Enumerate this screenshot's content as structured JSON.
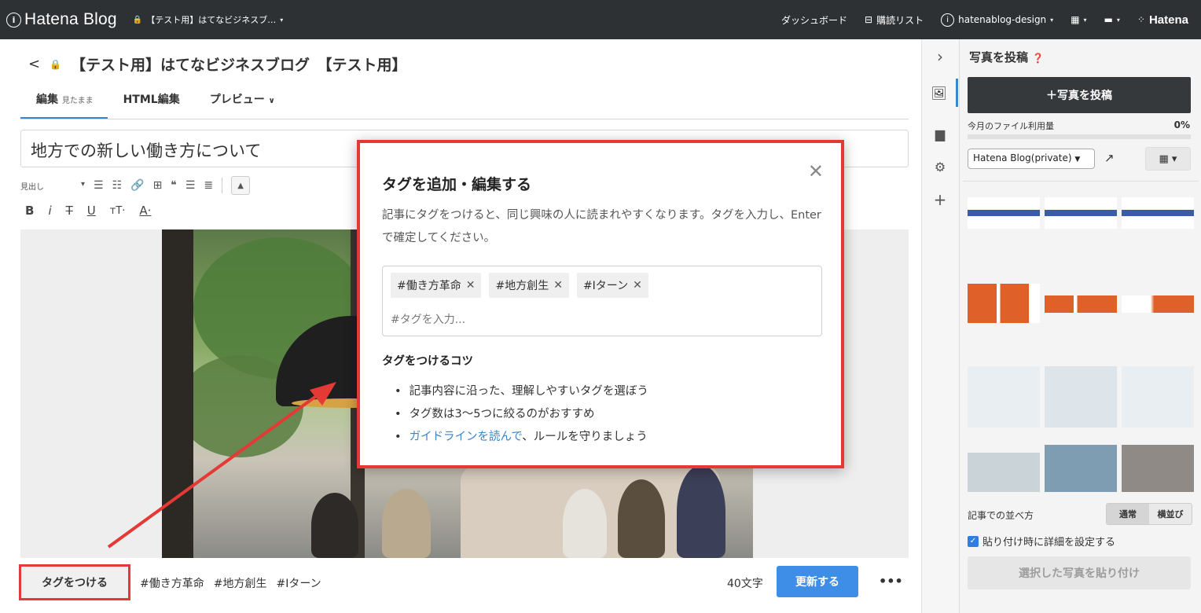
{
  "topbar": {
    "brand": "Hatena Blog",
    "brand_icon": "i",
    "blog_name": "【テスト用】はてなビジネスブ…",
    "dashboard": "ダッシュボード",
    "reading_list": "購読リスト",
    "user": "hatenablog-design",
    "hatena": "Hatena"
  },
  "editor": {
    "blog_title": "【テスト用】はてなビジネスブログ　【テスト用】",
    "tabs": {
      "edit": "編集",
      "edit_mode": "見たまま",
      "html": "HTML編集",
      "preview": "プレビュー"
    },
    "post_title": "地方での新しい働き方について",
    "heading_select": "見出し"
  },
  "bottom": {
    "tag_button": "タグをつける",
    "tags": [
      "#働き方革命",
      "#地方創生",
      "#Iターン"
    ],
    "char_count": "40文字",
    "update_button": "更新する",
    "more": "•••"
  },
  "panel": {
    "title": "写真を投稿",
    "post_button": "＋写真を投稿",
    "usage_label": "今月のファイル利用量",
    "usage_percent": "0%",
    "usage_value": 0,
    "album": "Hatena Blog(private)",
    "sort_label": "記事での並べ方",
    "sort_normal": "通常",
    "sort_horizontal": "横並び",
    "detail_checkbox": "貼り付け時に詳細を設定する",
    "paste_button": "選択した写真を貼り付け"
  },
  "modal": {
    "title": "タグを追加・編集する",
    "description": "記事にタグをつけると、同じ興味の人に読まれやすくなります。タグを入力し、Enterで確定してください。",
    "chips": [
      "#働き方革命",
      "#地方創生",
      "#Iターン"
    ],
    "input_placeholder": "#タグを入力...",
    "tips_title": "タグをつけるコツ",
    "tip1": "記事内容に沿った、理解しやすいタグを選ぼう",
    "tip2": "タグ数は3〜5つに絞るのがおすすめ",
    "tip3_link": "ガイドラインを読んで",
    "tip3_rest": "、ルールを守りましょう"
  },
  "colors": {
    "accent_blue": "#3e8ee8",
    "highlight_red": "#e53935",
    "topbar": "#2e3133"
  }
}
